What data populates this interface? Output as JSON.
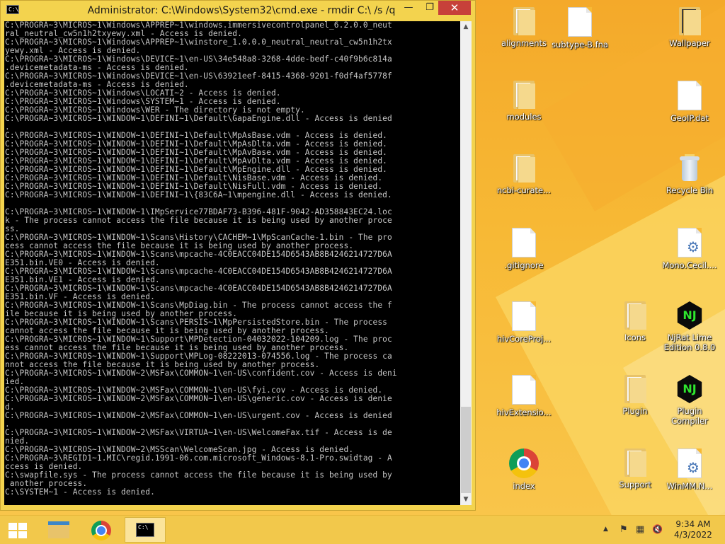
{
  "window": {
    "title": "Administrator: C:\\Windows\\System32\\cmd.exe - rmdir  C:\\ /s /q",
    "app_icon_text": "C:\\",
    "minimize_symbol": "—",
    "maximize_symbol": "❐",
    "close_symbol": "✕"
  },
  "console": {
    "output": "C:\\PROGRA~3\\MICROS~1\\Windows\\APPREP~1\\windows.immersivecontrolpanel_6.2.0.0_neut\nral_neutral_cw5n1h2txyewy.xml - Access is denied.\nC:\\PROGRA~3\\MICROS~1\\Windows\\APPREP~1\\winstore_1.0.0.0_neutral_neutral_cw5n1h2tx\nyewy.xml - Access is denied.\nC:\\PROGRA~3\\MICROS~1\\Windows\\DEVICE~1\\en-US\\34e548a8-3268-4dde-bedf-c40f9b6c814a\n.devicemetadata-ms - Access is denied.\nC:\\PROGRA~3\\MICROS~1\\Windows\\DEVICE~1\\en-US\\63921eef-8415-4368-9201-f0df4af5778f\n.devicemetadata-ms - Access is denied.\nC:\\PROGRA~3\\MICROS~1\\Windows\\LOCATI~2 - Access is denied.\nC:\\PROGRA~3\\MICROS~1\\Windows\\SYSTEM~1 - Access is denied.\nC:\\PROGRA~3\\MICROS~1\\Windows\\WER - The directory is not empty.\nC:\\PROGRA~3\\MICROS~1\\WINDOW~1\\DEFINI~1\\Default\\GapaEngine.dll - Access is denied\n.\nC:\\PROGRA~3\\MICROS~1\\WINDOW~1\\DEFINI~1\\Default\\MpAsBase.vdm - Access is denied.\nC:\\PROGRA~3\\MICROS~1\\WINDOW~1\\DEFINI~1\\Default\\MpAsDlta.vdm - Access is denied.\nC:\\PROGRA~3\\MICROS~1\\WINDOW~1\\DEFINI~1\\Default\\MpAvBase.vdm - Access is denied.\nC:\\PROGRA~3\\MICROS~1\\WINDOW~1\\DEFINI~1\\Default\\MpAvDlta.vdm - Access is denied.\nC:\\PROGRA~3\\MICROS~1\\WINDOW~1\\DEFINI~1\\Default\\MpEngine.dll - Access is denied.\nC:\\PROGRA~3\\MICROS~1\\WINDOW~1\\DEFINI~1\\Default\\NisBase.vdm - Access is denied.\nC:\\PROGRA~3\\MICROS~1\\WINDOW~1\\DEFINI~1\\Default\\NisFull.vdm - Access is denied.\nC:\\PROGRA~3\\MICROS~1\\WINDOW~1\\DEFINI~1\\{83C6A~1\\mpengine.dll - Access is denied.\n\nC:\\PROGRA~3\\MICROS~1\\WINDOW~1\\IMpService77BDAF73-B396-481F-9042-AD358843EC24.loc\nk - The process cannot access the file because it is being used by another proce\nss.\nC:\\PROGRA~3\\MICROS~1\\WINDOW~1\\Scans\\History\\CACHEM~1\\MpScanCache-1.bin - The pro\ncess cannot access the file because it is being used by another process.\nC:\\PROGRA~3\\MICROS~1\\WINDOW~1\\Scans\\mpcache-4C0EACC04DE154D6543AB8B4246214727D6A\nE351.bin.VE0 - Access is denied.\nC:\\PROGRA~3\\MICROS~1\\WINDOW~1\\Scans\\mpcache-4C0EACC04DE154D6543AB8B4246214727D6A\nE351.bin.VE1 - Access is denied.\nC:\\PROGRA~3\\MICROS~1\\WINDOW~1\\Scans\\mpcache-4C0EACC04DE154D6543AB8B4246214727D6A\nE351.bin.VF - Access is denied.\nC:\\PROGRA~3\\MICROS~1\\WINDOW~1\\Scans\\MpDiag.bin - The process cannot access the f\nile because it is being used by another process.\nC:\\PROGRA~3\\MICROS~1\\WINDOW~1\\Scans\\PERSIS~1\\MpPersistedStore.bin - The process\ncannot access the file because it is being used by another process.\nC:\\PROGRA~3\\MICROS~1\\WINDOW~1\\Support\\MPDetection-04032022-104209.log - The proc\ness cannot access the file because it is being used by another process.\nC:\\PROGRA~3\\MICROS~1\\WINDOW~1\\Support\\MPLog-08222013-074556.log - The process ca\nnnot access the file because it is being used by another process.\nC:\\PROGRA~3\\MICROS~1\\WINDOW~2\\MSFax\\COMMON~1\\en-US\\confident.cov - Access is deni\nied.\nC:\\PROGRA~3\\MICROS~1\\WINDOW~2\\MSFax\\COMMON~1\\en-US\\fyi.cov - Access is denied.\nC:\\PROGRA~3\\MICROS~1\\WINDOW~2\\MSFax\\COMMON~1\\en-US\\generic.cov - Access is denie\nd.\nC:\\PROGRA~3\\MICROS~1\\WINDOW~2\\MSFax\\COMMON~1\\en-US\\urgent.cov - Access is denied\n.\nC:\\PROGRA~3\\MICROS~1\\WINDOW~2\\MSFax\\VIRTUA~1\\en-US\\WelcomeFax.tif - Access is de\nnied.\nC:\\PROGRA~3\\MICROS~1\\WINDOW~2\\MSScan\\WelcomeScan.jpg - Access is denied.\nC:\\PROGRA~3\\REGID1~1.MIC\\regid.1991-06.com.microsoft_Windows-8.1-Pro.swidtag - A\nccess is denied.\nC:\\swapfile.sys - The process cannot access the file because it is being used by\n another process.\nC:\\SYSTEM~1 - Access is denied."
  },
  "desktop_icons": [
    {
      "name": "alignments",
      "type": "folder"
    },
    {
      "name": "subtype-B.fna",
      "type": "document"
    },
    {
      "name": "Wallpaper",
      "type": "folder"
    },
    {
      "name": "modules",
      "type": "folder"
    },
    {
      "name": "GeoIP.dat",
      "type": "document"
    },
    {
      "name": "ncbi-curate...",
      "type": "folder"
    },
    {
      "name": "Recycle Bin",
      "type": "recycle-bin"
    },
    {
      "name": ".gitignore",
      "type": "document"
    },
    {
      "name": "Mono.Cecil....",
      "type": "settings-document"
    },
    {
      "name": "hivCoreProj...",
      "type": "document"
    },
    {
      "name": "Icons",
      "type": "folder"
    },
    {
      "name": "NjRat Lime Edition 0.8.0",
      "type": "njrat-app"
    },
    {
      "name": "hivExtensio...",
      "type": "document"
    },
    {
      "name": "Plugin",
      "type": "folder"
    },
    {
      "name": "Plugin Compiler",
      "type": "njrat-app"
    },
    {
      "name": "index",
      "type": "chrome-shortcut"
    },
    {
      "name": "Support",
      "type": "folder"
    },
    {
      "name": "WinMM.N...",
      "type": "settings-document"
    }
  ],
  "icon_glyphs": {
    "nj": "NJ",
    "gear": "⚙"
  },
  "taskbar": {
    "items": [
      "start-button",
      "file-explorer",
      "chrome",
      "command-prompt"
    ],
    "cmd_icon_text": "C:\\",
    "tray": {
      "overflow": "▲",
      "flag": "⚑",
      "network": "▦",
      "volume": "🔇"
    },
    "time": "9:34 AM",
    "date": "4/3/2022"
  },
  "colors": {
    "console_bg": "#000000",
    "console_text": "#c6c6c6",
    "close_button": "#c7403a",
    "desktop_accent": "#f4a92a"
  }
}
